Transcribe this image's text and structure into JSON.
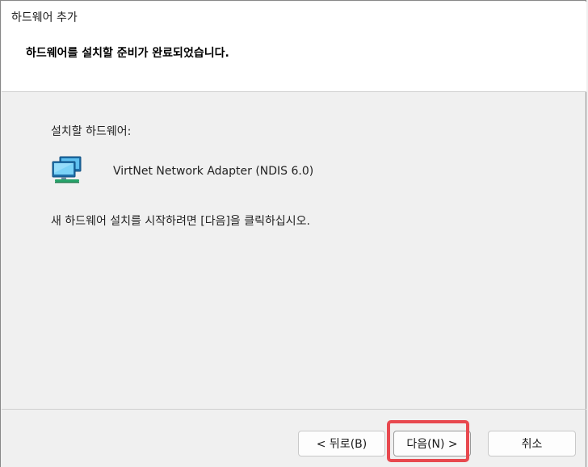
{
  "window": {
    "title": "하드웨어 추가"
  },
  "header": {
    "heading": "하드웨어를 설치할 준비가 완료되었습니다."
  },
  "main": {
    "install_label": "설치할 하드웨어:",
    "device": {
      "icon": "network-adapter-icon",
      "name": "VirtNet Network Adapter (NDIS 6.0)"
    },
    "instruction": "새 하드웨어 설치를 시작하려면 [다음]을 클릭하십시오."
  },
  "footer": {
    "back_label": "< 뒤로(B)",
    "next_label": "다음(N) >",
    "cancel_label": "취소",
    "highlight_color": "#e8494f"
  }
}
